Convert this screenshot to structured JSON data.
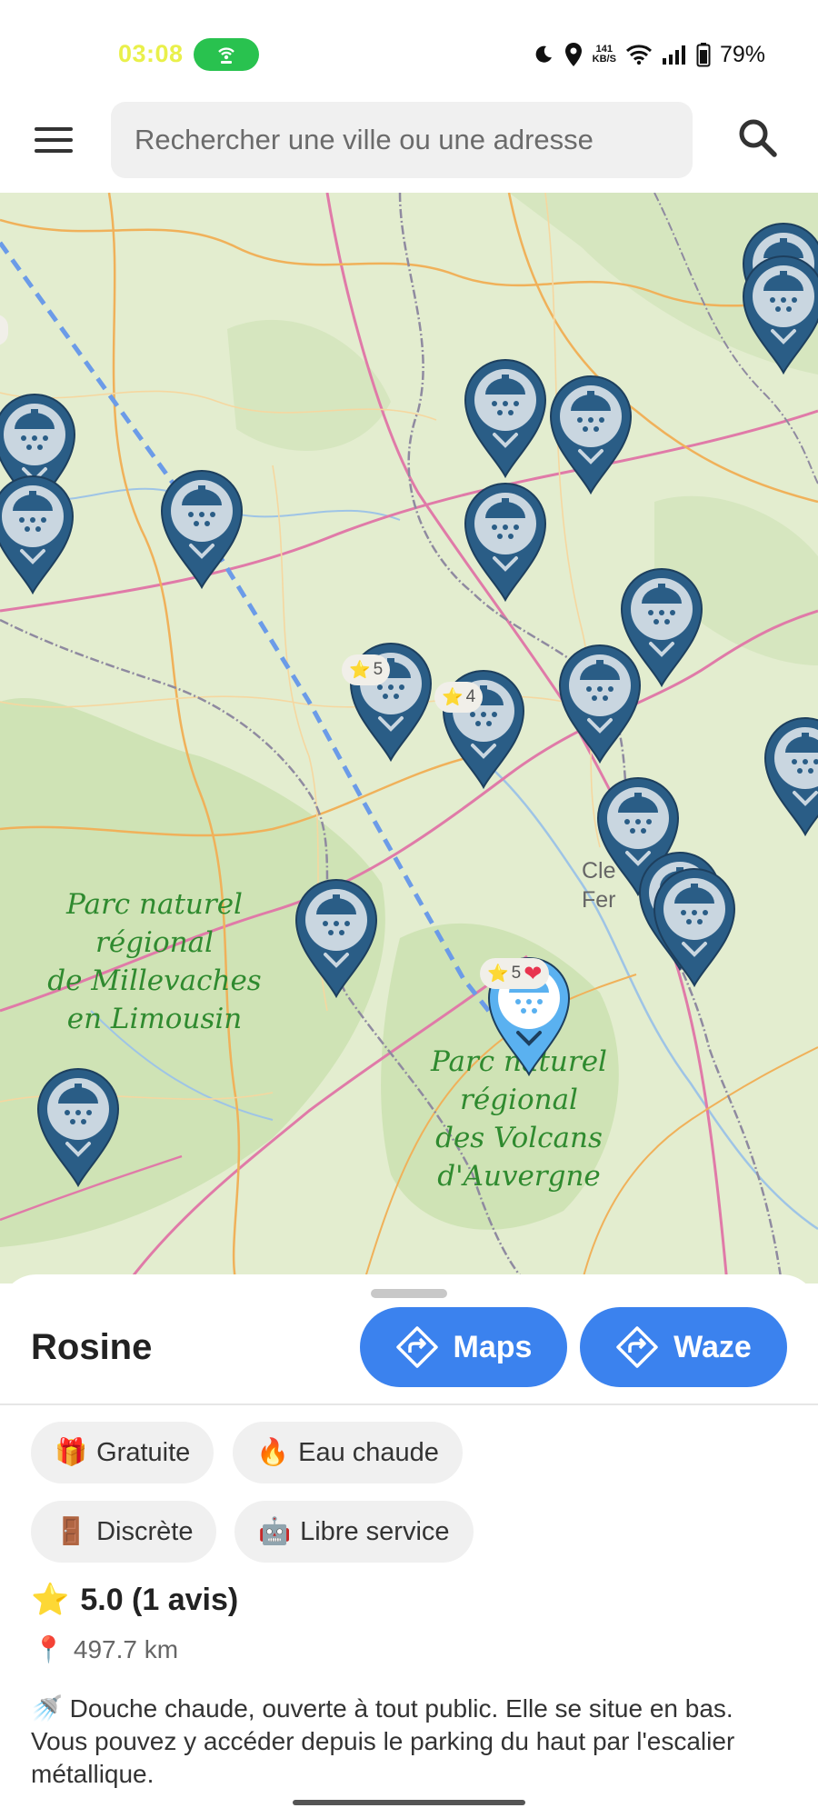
{
  "status_bar": {
    "time": "03:08",
    "net_speed_value": "141",
    "net_speed_unit": "KB/S",
    "battery": "79%"
  },
  "app_bar": {
    "search_placeholder": "Rechercher une ville ou une adresse"
  },
  "map": {
    "parks": [
      {
        "lines": [
          "Parc naturel",
          "régional",
          "de Millevaches",
          "en Limousin"
        ]
      },
      {
        "lines": [
          "Parc naturel",
          "régional",
          "des Volcans",
          "d'Auvergne"
        ]
      }
    ],
    "city_fragment": [
      "Cle",
      "Fer"
    ],
    "pin_badges": [
      "5",
      "5",
      "4",
      "5"
    ],
    "accent_color": "#3b82ee",
    "pin_color": "#2a5d86",
    "selected_pin_color": "#5ab1f0"
  },
  "sheet": {
    "place_name": "Rosine",
    "maps_label": "Maps",
    "waze_label": "Waze",
    "chips": [
      {
        "emoji": "🎁",
        "label": "Gratuite"
      },
      {
        "emoji": "🔥",
        "label": "Eau chaude"
      },
      {
        "emoji": "🚪",
        "label": "Discrète"
      },
      {
        "emoji": "🤖",
        "label": "Libre service"
      }
    ],
    "rating_emoji": "⭐",
    "rating_text": "5.0 (1 avis)",
    "distance_emoji": "📍",
    "distance": "497.7 km",
    "description_emoji": "🚿",
    "description": "Douche chaude, ouverte à tout public. Elle se situe en bas. Vous pouvez y accéder depuis le parking du haut par l'escalier métallique."
  }
}
